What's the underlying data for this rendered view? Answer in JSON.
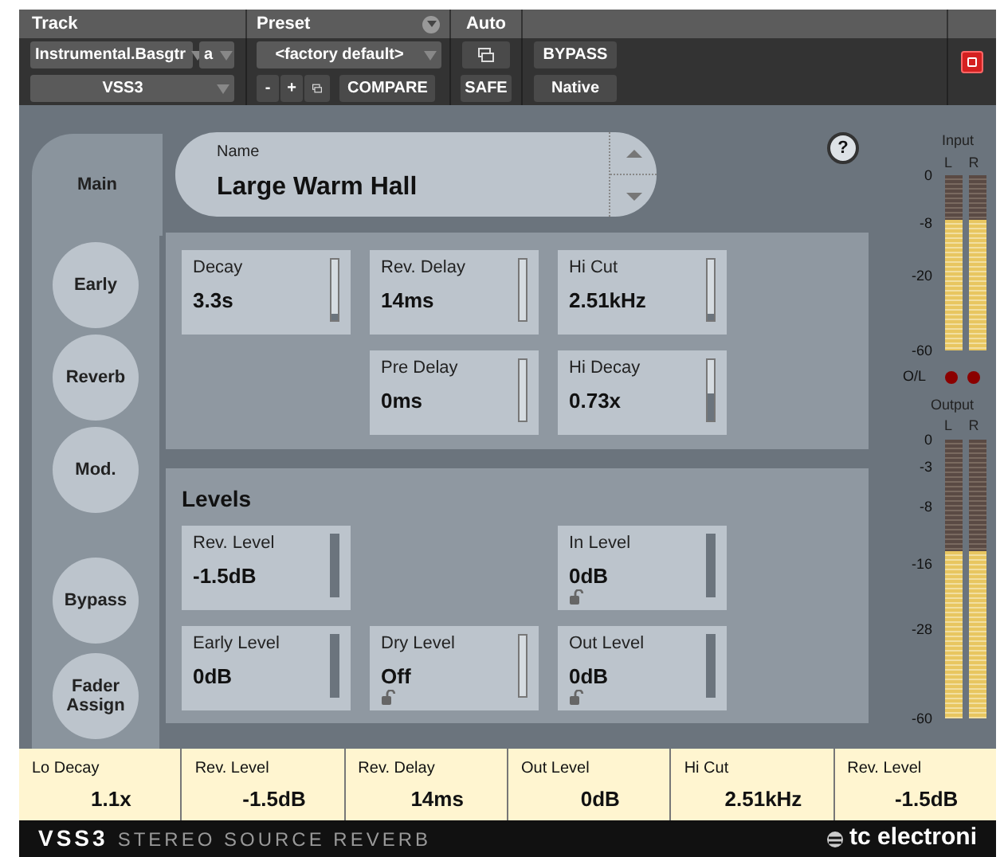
{
  "header": {
    "track_label": "Track",
    "preset_label": "Preset",
    "auto_label": "Auto",
    "track_name": "Instrumental.Basgtr",
    "channel": "a",
    "plugin": "VSS3",
    "preset": "<factory default>",
    "minus": "-",
    "plus": "+",
    "compare": "COMPARE",
    "safe": "SAFE",
    "bypass": "BYPASS",
    "native": "Native"
  },
  "tabs": [
    {
      "label": "Main",
      "selected": true
    },
    {
      "label": "Early",
      "selected": false
    },
    {
      "label": "Reverb",
      "selected": false
    },
    {
      "label": "Mod.",
      "selected": false
    }
  ],
  "side_buttons": [
    "Bypass",
    "Fader Assign"
  ],
  "name_field": {
    "label": "Name",
    "value": "Large Warm Hall"
  },
  "help": "?",
  "upper_panel": {
    "rows": [
      [
        {
          "kind": "param",
          "label": "Decay",
          "value": "3.3s",
          "level": 0.1
        },
        {
          "kind": "param",
          "label": "Rev. Delay",
          "value": "14ms",
          "level": 0
        },
        {
          "kind": "param",
          "label": "Hi Cut",
          "value": "2.51kHz",
          "level": 0.1
        }
      ],
      [
        {
          "kind": "empty"
        },
        {
          "kind": "param",
          "label": "Pre Delay",
          "value": "0ms",
          "level": 0
        },
        {
          "kind": "param",
          "label": "Hi Decay",
          "value": "0.73x",
          "level": 0.45
        }
      ]
    ]
  },
  "levels_panel": {
    "title": "Levels",
    "rows": [
      [
        {
          "kind": "param",
          "label": "Rev. Level",
          "value": "-1.5dB",
          "level": 1
        },
        {
          "kind": "empty"
        },
        {
          "kind": "param",
          "label": "In Level",
          "value": "0dB",
          "level": 1,
          "lock_icon": true
        }
      ],
      [
        {
          "kind": "param",
          "label": "Early Level",
          "value": "0dB",
          "level": 1
        },
        {
          "kind": "param",
          "label": "Dry Level",
          "value": "Off",
          "level": 0,
          "lock_icon": true
        },
        {
          "kind": "param",
          "label": "Out Level",
          "value": "0dB",
          "level": 1,
          "lock_icon": true
        }
      ]
    ]
  },
  "input_meter": {
    "label": "Input",
    "scale": [
      "0",
      "-8",
      "-20",
      "-60"
    ],
    "channels": [
      {
        "name": "L",
        "level": 0.75
      },
      {
        "name": "R",
        "level": 0.75
      }
    ]
  },
  "overload": {
    "label": "O/L"
  },
  "output_meter": {
    "label": "Output",
    "scale": [
      "0",
      "-3",
      "-8",
      "-16",
      "-28",
      "-60"
    ],
    "channels": [
      {
        "name": "L",
        "level": 0.6
      },
      {
        "name": "R",
        "level": 0.6
      }
    ]
  },
  "fader_strip": [
    {
      "label": "Lo Decay",
      "value": "1.1x"
    },
    {
      "label": "Rev. Level",
      "value": "-1.5dB"
    },
    {
      "label": "Rev. Delay",
      "value": "14ms"
    },
    {
      "label": "Out Level",
      "value": "0dB"
    },
    {
      "label": "Hi Cut",
      "value": "2.51kHz"
    },
    {
      "label": "Rev. Level",
      "value": "-1.5dB"
    }
  ],
  "footer": {
    "product": "VSS3",
    "subtitle": "STEREO SOURCE REVERB",
    "brand": "tc electroni"
  }
}
